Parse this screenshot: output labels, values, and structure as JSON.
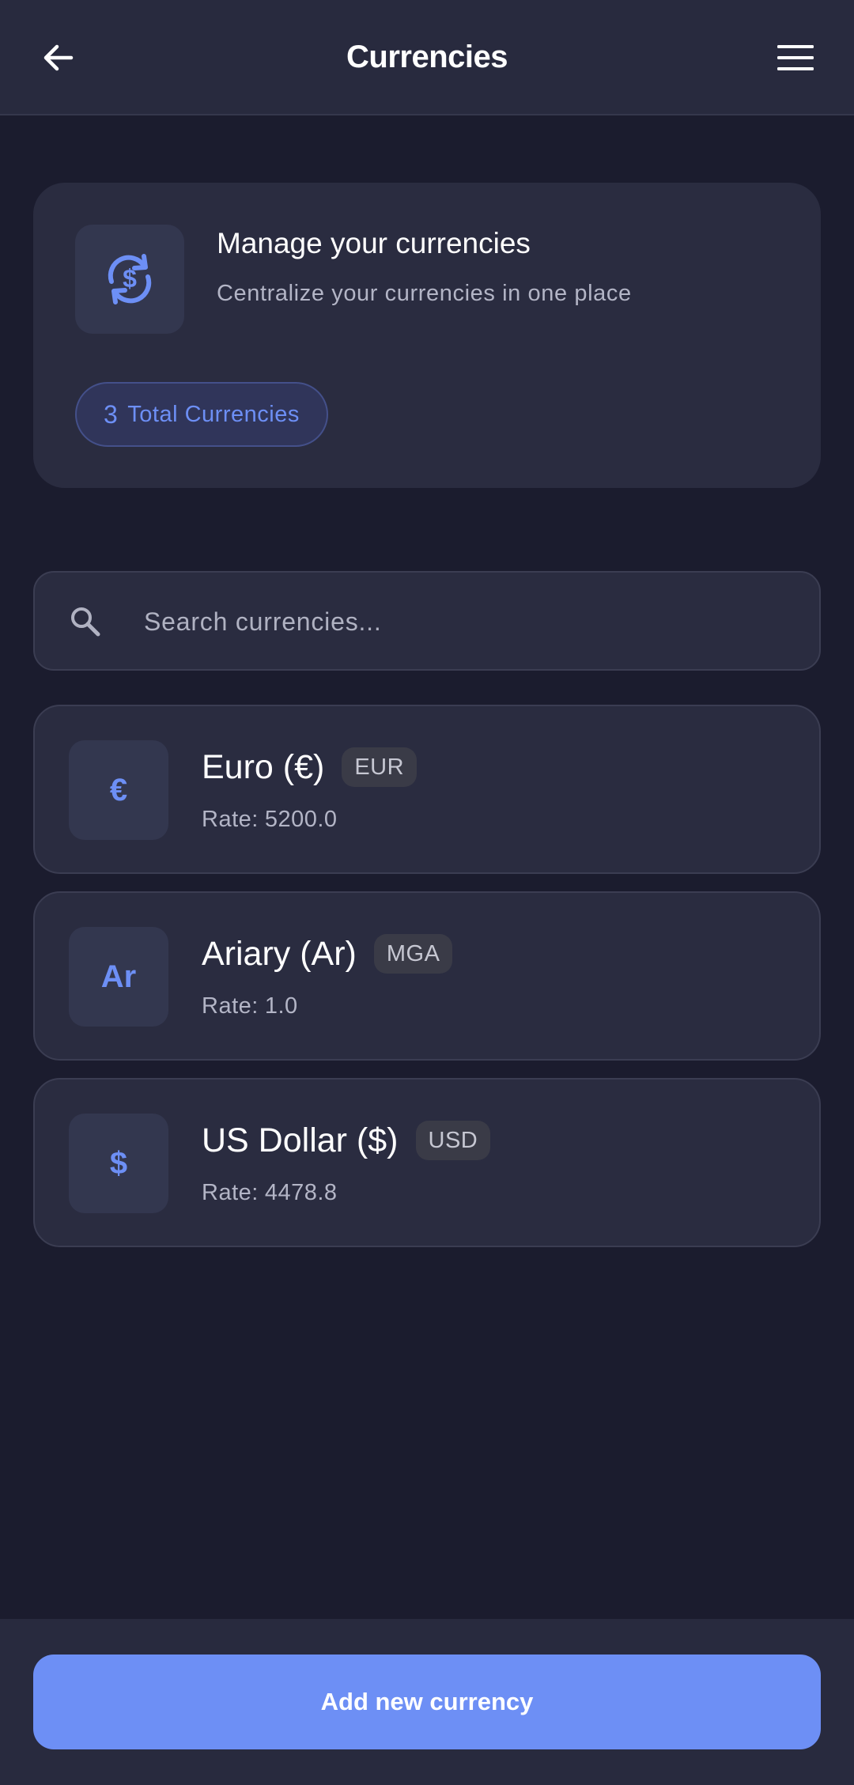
{
  "header": {
    "title": "Currencies",
    "back_icon": "arrow-left-icon",
    "menu_icon": "hamburger-menu-icon"
  },
  "summary": {
    "icon": "currency-exchange-icon",
    "title": "Manage your currencies",
    "subtitle": "Centralize your currencies in one place",
    "count": "3",
    "count_label": "Total Currencies"
  },
  "search": {
    "icon": "search-icon",
    "placeholder": "Search currencies...",
    "value": ""
  },
  "currencies": [
    {
      "symbol": "€",
      "name": "Euro (€)",
      "code": "EUR",
      "rate_label": "Rate:",
      "rate": "5200.0"
    },
    {
      "symbol": "Ar",
      "name": "Ariary (Ar)",
      "code": "MGA",
      "rate_label": "Rate:",
      "rate": "1.0"
    },
    {
      "symbol": "$",
      "name": "US Dollar ($)",
      "code": "USD",
      "rate_label": "Rate:",
      "rate": "4478.8"
    }
  ],
  "footer": {
    "add_label": "Add new currency"
  },
  "colors": {
    "background": "#1b1c2e",
    "surface": "#2a2c40",
    "accent": "#6d8ff5",
    "text_primary": "#ffffff",
    "text_secondary": "#b3b5c6"
  }
}
